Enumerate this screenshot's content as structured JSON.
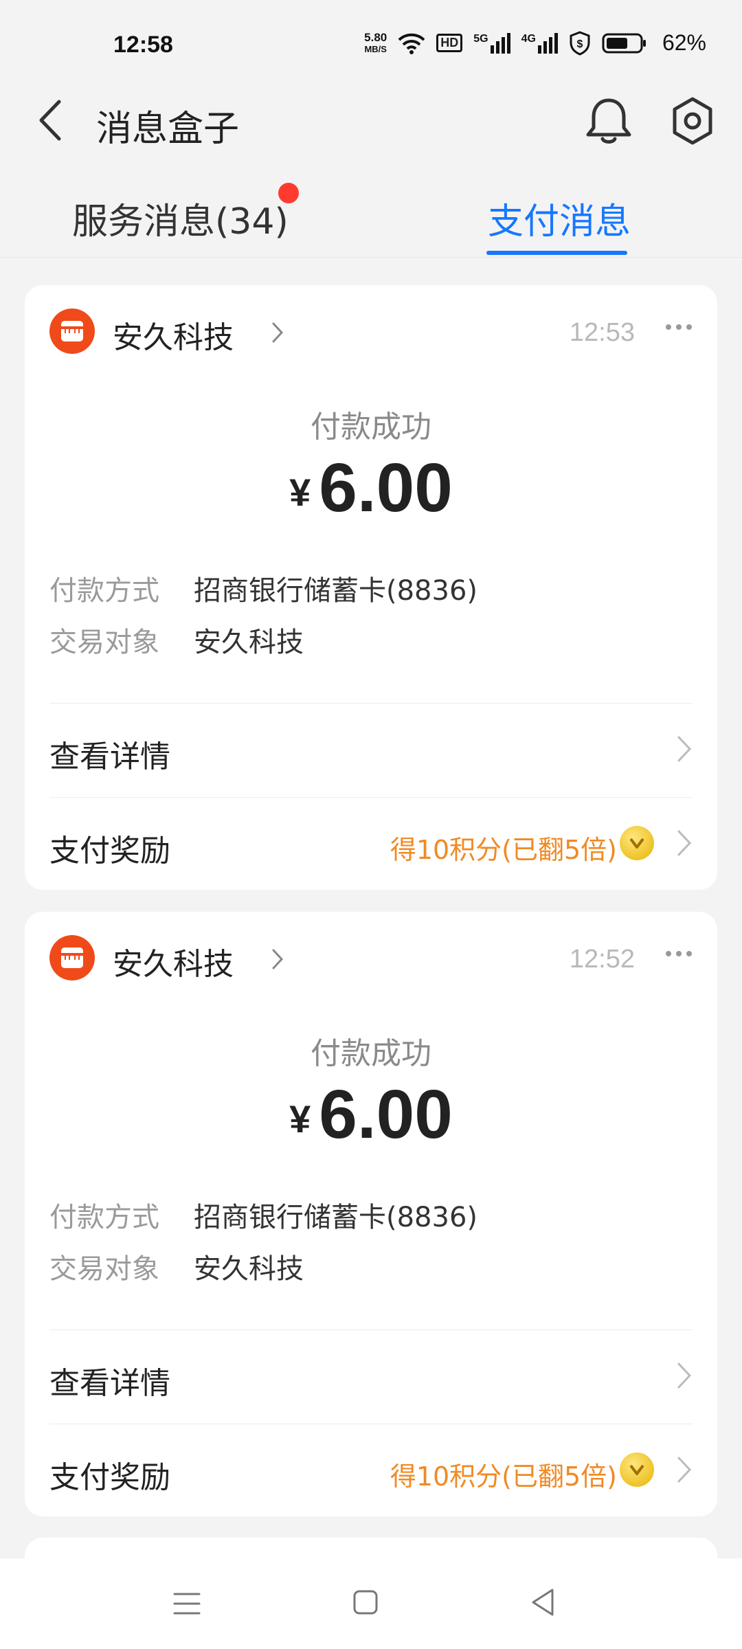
{
  "status_bar": {
    "time": "12:58",
    "net_speed_value": "5.80",
    "net_speed_unit": "MB/S",
    "hd_badge": "HD",
    "signal_1": "5G",
    "signal_2": "4G",
    "battery_percent": "62%"
  },
  "header": {
    "title": "消息盒子",
    "icons": [
      "back-icon",
      "bell-icon",
      "gear-icon"
    ]
  },
  "tabs": [
    {
      "label": "服务消息(34)",
      "active": false,
      "has_dot": true
    },
    {
      "label": "支付消息",
      "active": true
    }
  ],
  "colors": {
    "accent": "#1677ff",
    "reward": "#f08a24",
    "dot": "#ff3b30",
    "shop_avatar": "#f04a1a"
  },
  "messages": [
    {
      "shop": "安久科技",
      "time": "12:53",
      "status": "付款成功",
      "currency": "¥",
      "amount": "6.00",
      "method_label": "付款方式",
      "method_value": "招商银行储蓄卡(8836)",
      "party_label": "交易对象",
      "party_value": "安久科技",
      "detail_label": "查看详情",
      "reward_label": "支付奖励",
      "reward_value": "得10积分(已翻5倍)"
    },
    {
      "shop": "安久科技",
      "time": "12:52",
      "status": "付款成功",
      "currency": "¥",
      "amount": "6.00",
      "method_label": "付款方式",
      "method_value": "招商银行储蓄卡(8836)",
      "party_label": "交易对象",
      "party_value": "安久科技",
      "detail_label": "查看详情",
      "reward_label": "支付奖励",
      "reward_value": "得10积分(已翻5倍)"
    }
  ]
}
